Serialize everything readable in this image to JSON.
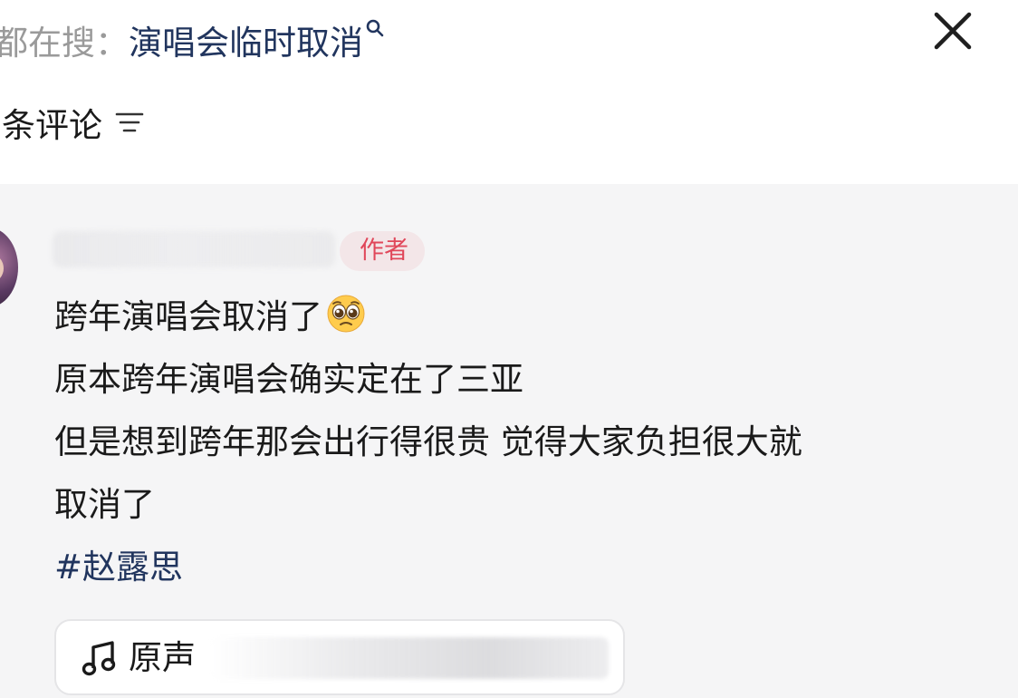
{
  "search": {
    "prefix": "都在搜：",
    "query": "演唱会临时取消",
    "icon": "search-icon"
  },
  "close": {
    "icon": "close-icon"
  },
  "comments_header": {
    "label": "条评论",
    "sort_icon": "sort-filter-icon"
  },
  "comment": {
    "author_badge": "作者",
    "lines": [
      "跨年演唱会取消了",
      "原本跨年演唱会确实定在了三亚",
      "但是想到跨年那会出行得很贵 觉得大家负担很大就",
      "取消了"
    ],
    "emoji": "pleading-face-emoji",
    "hashtag": "#赵露思"
  },
  "sound": {
    "icon": "music-note-icon",
    "label": "原声"
  },
  "colors": {
    "query_text": "#21355e",
    "hashtag_text": "#21355e",
    "author_badge_text": "#e0475a",
    "author_badge_bg": "#f3e6e8",
    "card_bg": "#f5f5f6"
  }
}
